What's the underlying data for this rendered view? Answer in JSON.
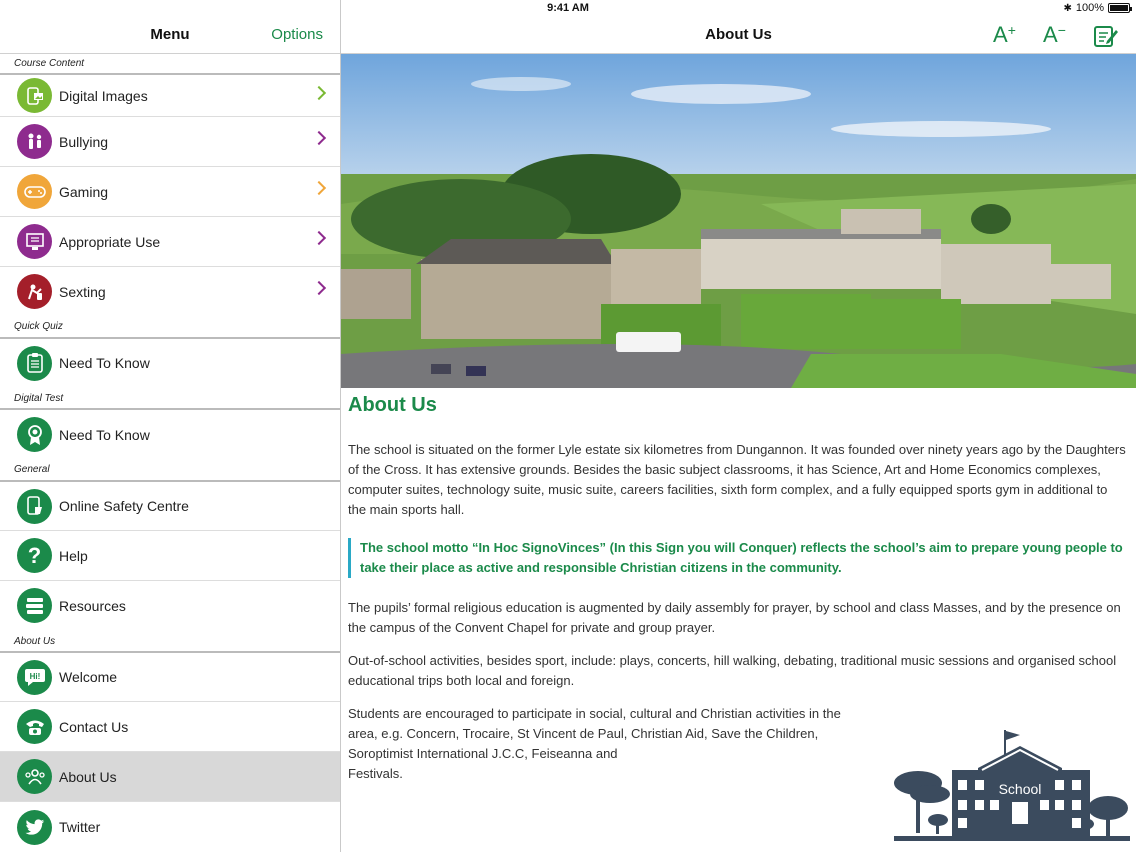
{
  "status_bar": {
    "device": "iPad",
    "time": "9:41 AM",
    "battery": "100%"
  },
  "sidebar": {
    "title": "Menu",
    "options_label": "Options",
    "sections": [
      {
        "label": "Course Content",
        "items": [
          {
            "label": "Digital Images",
            "icon": "digital-images-icon",
            "color": "#7ab934",
            "chevron": true
          },
          {
            "label": "Bullying",
            "icon": "bullying-icon",
            "color": "#8e2b8e",
            "chevron": true
          },
          {
            "label": "Gaming",
            "icon": "gaming-icon",
            "color": "#f0a63a",
            "chevron": true
          },
          {
            "label": "Appropriate Use",
            "icon": "appropriate-use-icon",
            "color": "#8e2b8e",
            "chevron": true
          },
          {
            "label": "Sexting",
            "icon": "sexting-icon",
            "color": "#a41f2a",
            "chevron": true
          }
        ]
      },
      {
        "label": "Quick Quiz",
        "items": [
          {
            "label": "Need To Know",
            "icon": "clipboard-icon",
            "color": "#1b8a4a"
          }
        ]
      },
      {
        "label": "Digital Test",
        "items": [
          {
            "label": "Need To Know",
            "icon": "award-icon",
            "color": "#1b8a4a"
          }
        ]
      },
      {
        "label": "General",
        "items": [
          {
            "label": "Online Safety Centre",
            "icon": "tablet-icon",
            "color": "#1b8a4a"
          },
          {
            "label": "Help",
            "icon": "question-icon",
            "color": "#1b8a4a"
          },
          {
            "label": "Resources",
            "icon": "books-icon",
            "color": "#1b8a4a"
          }
        ]
      },
      {
        "label": "About Us",
        "items": [
          {
            "label": "Welcome",
            "icon": "hi-bubble-icon",
            "color": "#1b8a4a"
          },
          {
            "label": "Contact Us",
            "icon": "phone-icon",
            "color": "#1b8a4a"
          },
          {
            "label": "About Us",
            "icon": "people-icon",
            "color": "#1b8a4a",
            "selected": true
          },
          {
            "label": "Twitter",
            "icon": "twitter-icon",
            "color": "#1b8a4a"
          }
        ]
      }
    ]
  },
  "topbar": {
    "title": "About Us",
    "font_increase": "A",
    "font_decrease": "A",
    "accent": "#1b8a4a"
  },
  "content": {
    "heading": "About Us",
    "paragraph1": "The school is situated on the former Lyle estate six kilometres from Dungannon. It was founded over ninety years ago by the Daughters of the Cross. It has extensive grounds. Besides the basic subject classrooms, it has Science, Art and Home Economics complexes, computer suites, technology suite, music suite, careers facilities, sixth form complex, and a fully equipped sports gym in additional to the main sports hall.",
    "quote": "The school motto “In Hoc SignoVinces” (In this Sign you will Conquer) reflects the school’s aim to prepare young people to take their place as active and responsible Christian citizens in the community.",
    "paragraph2": "The pupils’ formal religious education is augmented by daily assembly for prayer, by school and class Masses, and by the presence on the campus of the Convent Chapel for private and group prayer.",
    "paragraph3": "Out-of-school activities, besides sport, include: plays, concerts, hill walking, debating, traditional music sessions and organised school educational trips both local and foreign.",
    "paragraph4a": "Students are encouraged to participate in social, cultural and Christian activities in the area, e.g. Concern, Trocaire, St Vincent de Paul, Christian Aid, Save the Children, Soroptimist International J.C.C, Feiseanna and",
    "paragraph4b": "Festivals.",
    "school_sign": "School"
  }
}
